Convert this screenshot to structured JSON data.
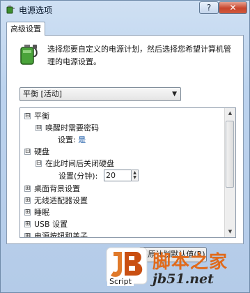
{
  "window": {
    "title": "电源选项",
    "help_label": "?",
    "close_label": "✕"
  },
  "tab": {
    "label": "高级设置"
  },
  "description": "选择您要自定义的电源计划，然后选择您希望计算机管理的电源设置。",
  "plan_select": {
    "value": "平衡 [活动]"
  },
  "tree": {
    "items": [
      {
        "label": "平衡",
        "expander": "⊟"
      },
      {
        "label": "唤醒时需要密码",
        "expander": "⊟"
      },
      {
        "setting_label": "设置:",
        "setting_value": "是"
      },
      {
        "label": "硬盘",
        "expander": "⊟"
      },
      {
        "label": "在此时间后关闭硬盘",
        "expander": "⊟"
      },
      {
        "setting_label": "设置(分钟):",
        "setting_value": "20"
      },
      {
        "label": "桌面背景设置",
        "expander": "⊞"
      },
      {
        "label": "无线适配器设置",
        "expander": "⊞"
      },
      {
        "label": "睡眠",
        "expander": "⊞"
      },
      {
        "label": "USB 设置",
        "expander": "⊞"
      },
      {
        "label": "电源按钮和盖子",
        "expander": "⊞"
      }
    ]
  },
  "restore_button": {
    "label": "还原计划默认值(R)"
  },
  "watermark": {
    "badge_script": "Script",
    "site_name": "脚本之家",
    "site_url": "jb51.net"
  },
  "colors": {
    "link": "#1a5aa6",
    "watermark_orange": "#e06a1b",
    "close_red": "#c8452c"
  },
  "icons": {
    "title": "power-options-icon",
    "panel": "battery-plug-icon"
  }
}
